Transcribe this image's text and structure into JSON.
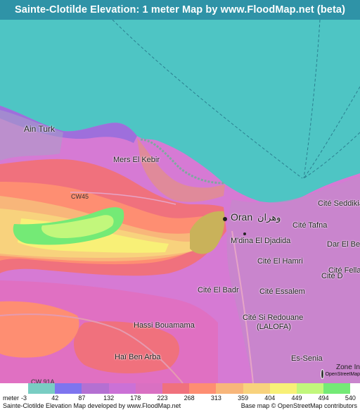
{
  "title": "Sainte-Clotilde Elevation: 1 meter Map by www.FloodMap.net (beta)",
  "colors": {
    "title_bar": "#2f93a7",
    "sea": "#4ec5c4",
    "low_land": "#d67ad4",
    "urban_gray": "#b9b2c2"
  },
  "map": {
    "place_labels": [
      {
        "text": "Ain Turk",
        "name": "label-ain-turk"
      },
      {
        "text": "Mers El Kebir",
        "name": "label-mers-el-kebir"
      },
      {
        "text": "CW45",
        "name": "label-cw45"
      },
      {
        "text": "Oran",
        "name": "label-oran"
      },
      {
        "text": "وهران",
        "name": "label-oran-arabic"
      },
      {
        "text": "Cité Seddikia",
        "name": "label-cite-seddikia"
      },
      {
        "text": "Cité Tafna",
        "name": "label-cite-tafna"
      },
      {
        "text": "M'dina El Djadida",
        "name": "label-mdina-el-djadida"
      },
      {
        "text": "Dar El Be",
        "name": "label-dar-el-be"
      },
      {
        "text": "Cité El Hamri",
        "name": "label-cite-el-hamri"
      },
      {
        "text": "Cité Fella",
        "name": "label-cite-fella"
      },
      {
        "text": "Cité D",
        "name": "label-cite-d"
      },
      {
        "text": "Cité El Badr",
        "name": "label-cite-el-badr"
      },
      {
        "text": "Cité Essalem",
        "name": "label-cite-essalem"
      },
      {
        "text": "Cité Si Redouane",
        "name": "label-cite-si-redouane"
      },
      {
        "text": "(LALOFA)",
        "name": "label-lalofa"
      },
      {
        "text": "Hassi Bouamama",
        "name": "label-hassi-bouamama"
      },
      {
        "text": "Haï Ben Arba",
        "name": "label-hai-ben-arba"
      },
      {
        "text": "CW 91A",
        "name": "label-cw91a"
      },
      {
        "text": "Es-Senia",
        "name": "label-es-senia"
      },
      {
        "text": "Zone In",
        "name": "label-zone-in"
      }
    ]
  },
  "legend": {
    "unit_label": "meter",
    "ticks": [
      "-3",
      "42",
      "87",
      "132",
      "178",
      "223",
      "268",
      "313",
      "359",
      "404",
      "449",
      "494",
      "540"
    ],
    "swatch_colors": [
      "#79cdc3",
      "#7e75ef",
      "#b470d2",
      "#cb71d6",
      "#d970c2",
      "#f0717d",
      "#fe8e72",
      "#f8b67a",
      "#f8d27d",
      "#f8f077",
      "#c2f77c",
      "#74ea76"
    ]
  },
  "footer": {
    "left": "Sainte-Clotilde Elevation Map developed by www.FloodMap.net",
    "right": "Base map © OpenStreetMap contributors"
  },
  "osm_logo_text": "OpenStreetMap"
}
